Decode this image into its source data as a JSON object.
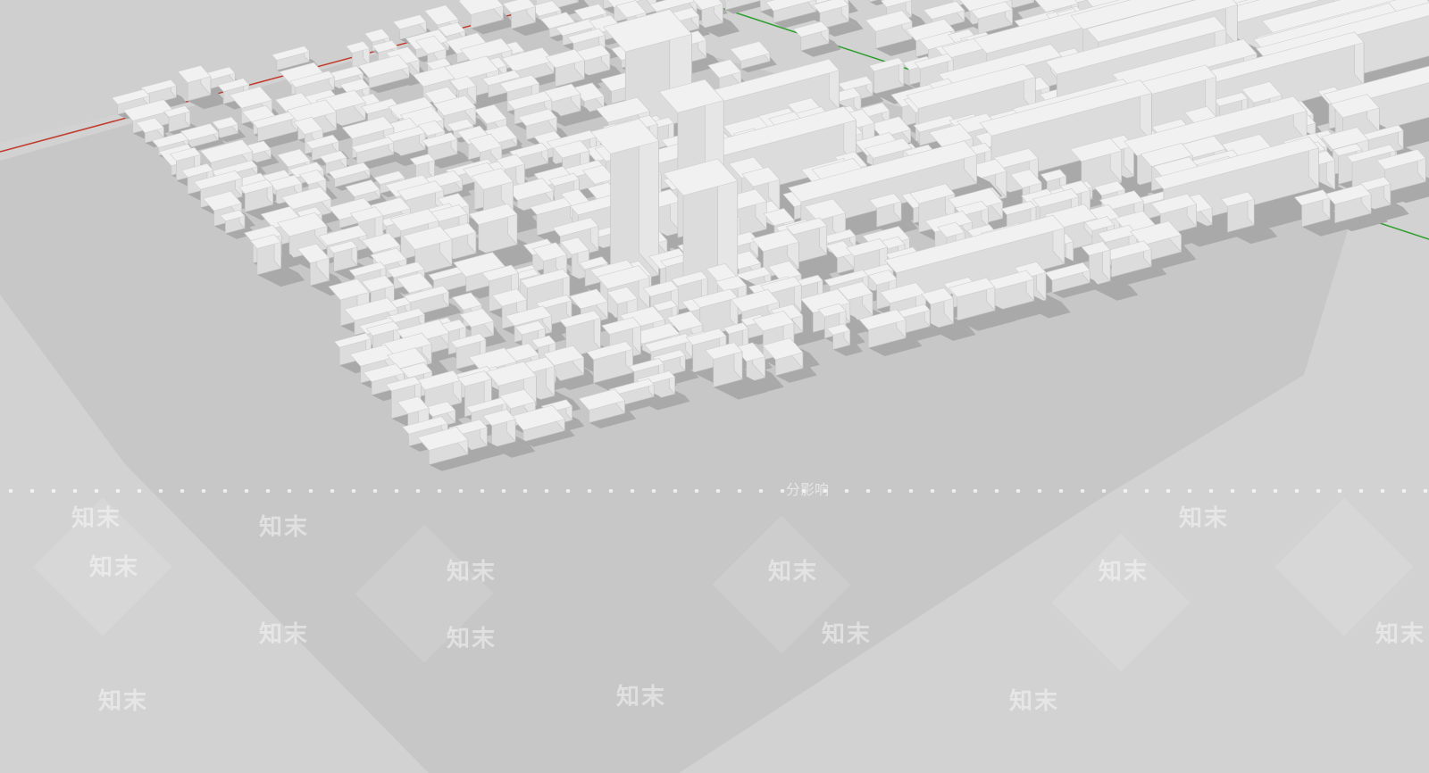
{
  "viewport": {
    "name": "3D model viewport",
    "background_color": "#cfcfcf",
    "ground_color": "#d2d2d2",
    "building_color": "#f1f1f1",
    "building_side_color": "#dcdcdc",
    "shadow_color": "#a9a9a9",
    "axis_red_color": "#c0392b",
    "axis_green_color": "#2e9e2e",
    "axis_blue_color": "#3a3aa8"
  },
  "watermark": {
    "repeat_text": "知末",
    "caption_text": "分影响"
  }
}
